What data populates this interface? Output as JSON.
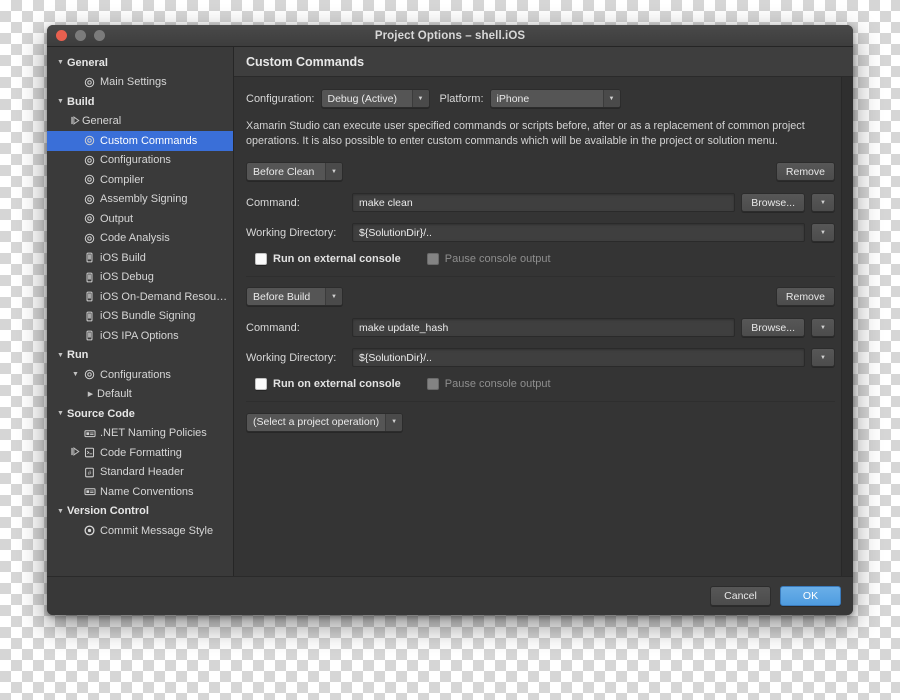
{
  "window": {
    "title": "Project Options – shell.iOS",
    "traffic_lights": [
      "close",
      "minimize",
      "maximize"
    ]
  },
  "sidebar": {
    "items": [
      {
        "label": "General",
        "level": 0,
        "twist": "down",
        "icon": "none",
        "group": true,
        "selected": false
      },
      {
        "label": "Main Settings",
        "level": 1,
        "twist": "none",
        "icon": "gear",
        "group": false,
        "selected": false
      },
      {
        "label": "Build",
        "level": 0,
        "twist": "down",
        "icon": "none",
        "group": true,
        "selected": false
      },
      {
        "label": "General",
        "level": 1,
        "twist": "right",
        "icon": "none",
        "group": false,
        "selected": false
      },
      {
        "label": "Custom Commands",
        "level": 1,
        "twist": "none",
        "icon": "gear",
        "group": false,
        "selected": true
      },
      {
        "label": "Configurations",
        "level": 1,
        "twist": "none",
        "icon": "gear",
        "group": false,
        "selected": false
      },
      {
        "label": "Compiler",
        "level": 1,
        "twist": "none",
        "icon": "gear",
        "group": false,
        "selected": false
      },
      {
        "label": "Assembly Signing",
        "level": 1,
        "twist": "none",
        "icon": "gear",
        "group": false,
        "selected": false
      },
      {
        "label": "Output",
        "level": 1,
        "twist": "none",
        "icon": "gear",
        "group": false,
        "selected": false
      },
      {
        "label": "Code Analysis",
        "level": 1,
        "twist": "none",
        "icon": "gear",
        "group": false,
        "selected": false
      },
      {
        "label": "iOS Build",
        "level": 1,
        "twist": "none",
        "icon": "phone",
        "group": false,
        "selected": false
      },
      {
        "label": "iOS Debug",
        "level": 1,
        "twist": "none",
        "icon": "phone",
        "group": false,
        "selected": false
      },
      {
        "label": "iOS On-Demand Resources",
        "level": 1,
        "twist": "none",
        "icon": "phone",
        "group": false,
        "selected": false
      },
      {
        "label": "iOS Bundle Signing",
        "level": 1,
        "twist": "none",
        "icon": "phone",
        "group": false,
        "selected": false
      },
      {
        "label": "iOS IPA Options",
        "level": 1,
        "twist": "none",
        "icon": "phone",
        "group": false,
        "selected": false
      },
      {
        "label": "Run",
        "level": 0,
        "twist": "down",
        "icon": "none",
        "group": true,
        "selected": false
      },
      {
        "label": "Configurations",
        "level": 1,
        "twist": "down",
        "icon": "gear",
        "group": false,
        "selected": false
      },
      {
        "label": "Default",
        "level": 2,
        "twist": "right-solid",
        "icon": "none",
        "group": false,
        "selected": false
      },
      {
        "label": "Source Code",
        "level": 0,
        "twist": "down",
        "icon": "none",
        "group": true,
        "selected": false
      },
      {
        "label": ".NET Naming Policies",
        "level": 1,
        "twist": "none",
        "icon": "card",
        "group": false,
        "selected": false
      },
      {
        "label": "Code Formatting",
        "level": 1,
        "twist": "right",
        "icon": "doc",
        "group": false,
        "selected": false
      },
      {
        "label": "Standard Header",
        "level": 1,
        "twist": "none",
        "icon": "hash",
        "group": false,
        "selected": false
      },
      {
        "label": "Name Conventions",
        "level": 1,
        "twist": "none",
        "icon": "card",
        "group": false,
        "selected": false
      },
      {
        "label": "Version Control",
        "level": 0,
        "twist": "down",
        "icon": "none",
        "group": true,
        "selected": false
      },
      {
        "label": "Commit Message Style",
        "level": 1,
        "twist": "none",
        "icon": "gear-filled",
        "group": false,
        "selected": false
      }
    ]
  },
  "content": {
    "header_title": "Custom Commands",
    "configuration_label": "Configuration:",
    "configuration_value": "Debug (Active)",
    "platform_label": "Platform:",
    "platform_value": "iPhone",
    "description": "Xamarin Studio can execute user specified commands or scripts before, after or as a replacement of common project operations. It is also possible to enter custom commands which will be available in the project or solution menu.",
    "command_label": "Command:",
    "working_dir_label": "Working Directory:",
    "browse_label": "Browse...",
    "remove_label": "Remove",
    "run_external_label": "Run on external console",
    "pause_output_label": "Pause console output",
    "commands": [
      {
        "trigger": "Before Clean",
        "command": "make clean",
        "working_directory": "${SolutionDir}/..",
        "run_on_external_console": false,
        "pause_console_output": false,
        "pause_disabled": true
      },
      {
        "trigger": "Before Build",
        "command": "make update_hash",
        "working_directory": "${SolutionDir}/..",
        "run_on_external_console": false,
        "pause_console_output": false,
        "pause_disabled": true
      }
    ],
    "add_operation_placeholder": "(Select a project operation)"
  },
  "footer": {
    "cancel_label": "Cancel",
    "ok_label": "OK"
  },
  "colors": {
    "selection_blue": "#3a6fd8",
    "primary_button_blue": "#4f9ce0",
    "window_background": "#343434",
    "sidebar_background": "#3a3a3a",
    "close_button_red": "#e8604f"
  }
}
